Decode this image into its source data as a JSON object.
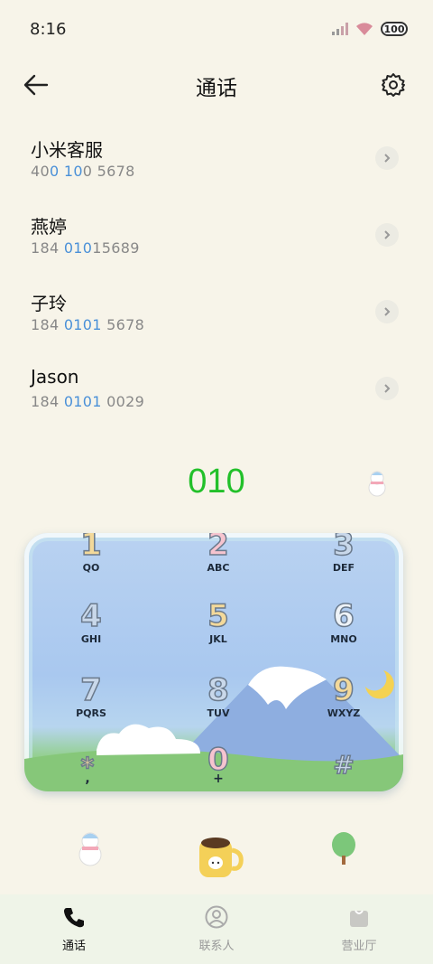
{
  "status": {
    "time": "8:16",
    "battery": "100"
  },
  "header": {
    "title": "通话"
  },
  "contacts": [
    {
      "name": "小米客服",
      "number_parts": [
        "40",
        "0 10",
        "0 5678"
      ]
    },
    {
      "name": "燕婷",
      "number_parts": [
        "184 ",
        "010",
        "15689"
      ]
    },
    {
      "name": "子玲",
      "number_parts": [
        "184 ",
        "0101",
        " 5678"
      ]
    },
    {
      "name": "Jason",
      "number_parts": [
        "184 ",
        "0101",
        " 0029"
      ]
    }
  ],
  "dialer": {
    "display": "010",
    "keys": [
      {
        "digit": "1",
        "letters": "QO",
        "color": "#f3d99a"
      },
      {
        "digit": "2",
        "letters": "ABC",
        "color": "#f6c4cf"
      },
      {
        "digit": "3",
        "letters": "DEF",
        "color": "#c9d8ea"
      },
      {
        "digit": "4",
        "letters": "GHI",
        "color": "#c9d8ea"
      },
      {
        "digit": "5",
        "letters": "JKL",
        "color": "#f3d99a"
      },
      {
        "digit": "6",
        "letters": "MNO",
        "color": "#eef3f8"
      },
      {
        "digit": "7",
        "letters": "PQRS",
        "color": "#c9d8ea"
      },
      {
        "digit": "8",
        "letters": "TUV",
        "color": "#c9d8ea"
      },
      {
        "digit": "9",
        "letters": "WXYZ",
        "color": "#f3d99a"
      },
      {
        "digit": "*",
        "letters": ",",
        "color": "#f3d99a"
      },
      {
        "digit": "0",
        "letters": "+",
        "color": "#f6c4cf"
      },
      {
        "digit": "#",
        "letters": "",
        "color": "#c9d8ea"
      }
    ]
  },
  "tabs": [
    {
      "label": "通话",
      "icon": "phone-icon",
      "active": true
    },
    {
      "label": "联系人",
      "icon": "person-icon",
      "active": false
    },
    {
      "label": "营业厅",
      "icon": "bag-icon",
      "active": false
    }
  ],
  "colors": {
    "accent_green": "#22c02a",
    "highlight_blue": "#4a90d8",
    "background": "#f7f4e9"
  }
}
